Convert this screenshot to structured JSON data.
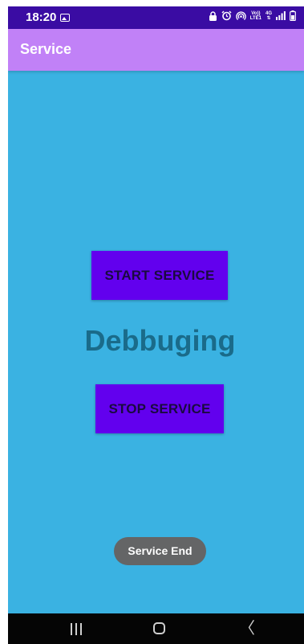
{
  "status_bar": {
    "time": "18:20",
    "icons": [
      "gallery-icon",
      "vpn-lock-icon",
      "alarm-icon",
      "hotspot-icon",
      "volte-icon",
      "4g-icon",
      "signal-icon",
      "battery-icon"
    ],
    "volte_line1": "Vo))",
    "volte_line2": "LTE1",
    "network_line1": "4G",
    "network_line2": "⇅"
  },
  "app_bar": {
    "title": "Service"
  },
  "main": {
    "start_button_label": "START SERVICE",
    "status_text": "Debbuging",
    "stop_button_label": "STOP SERVICE"
  },
  "toast": {
    "message": "Service End"
  },
  "nav_bar": {
    "recents_icon": "recents-icon",
    "home_icon": "home-icon",
    "back_icon": "back-icon",
    "back_glyph": "〈"
  },
  "colors": {
    "status_bar": "#3a0ca3",
    "app_bar": "#c181f7",
    "background": "#3ab2e2",
    "button": "#6200ee",
    "status_text": "#1a6b8a",
    "toast": "#646566",
    "nav_bar": "#050505"
  }
}
